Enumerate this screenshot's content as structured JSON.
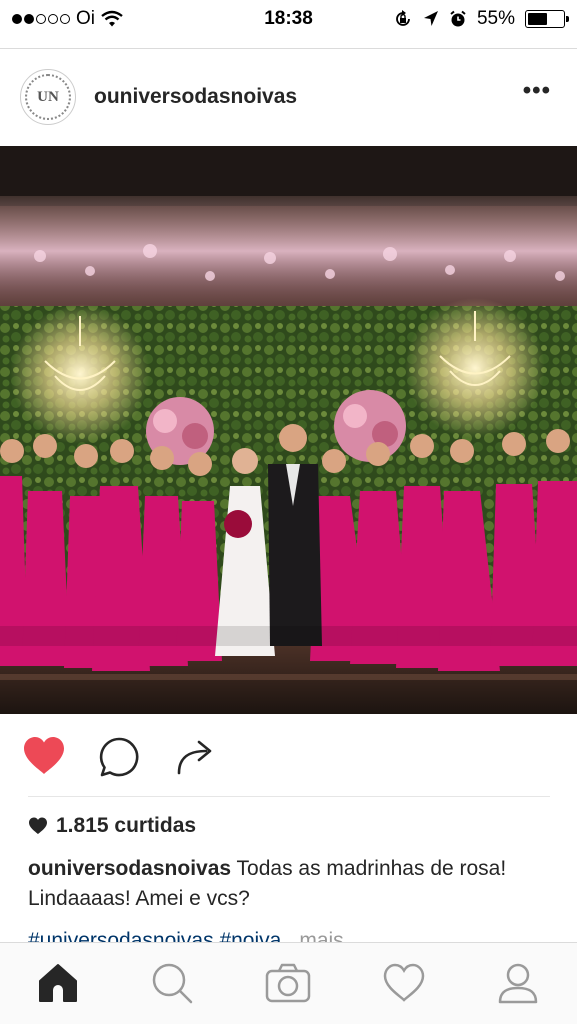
{
  "status_bar": {
    "carrier": "Oi",
    "time": "18:38",
    "battery": "55%",
    "battery_level": 0.55,
    "icons": [
      "signal-dots-icon",
      "wifi-icon",
      "orientation-lock-icon",
      "location-arrow-icon",
      "alarm-icon",
      "battery-icon"
    ]
  },
  "post": {
    "avatar_text": "UN",
    "username": "ouniversodasnoivas",
    "more_label": "•••",
    "image_alt": "Noiva, noivo e madrinhas de vestido rosa diante de parede de flores com lustres",
    "liked": true,
    "likes": "1.815 curtidas",
    "caption_user": "ouniversodasnoivas",
    "caption_text": "Todas as madrinhas de rosa! Lindaaaas! Amei e vcs?",
    "hashtags": "#universodasnoivas #noiva",
    "more_text": "mais"
  },
  "actions": {
    "icons": [
      "heart-icon",
      "comment-icon",
      "share-icon"
    ]
  },
  "tab_bar": {
    "items": [
      "home",
      "search",
      "camera",
      "activity",
      "profile"
    ]
  },
  "colors": {
    "like_red": "#ed4956",
    "link_blue": "#003569",
    "text": "#262626",
    "dress_pink": "#d1126e"
  }
}
